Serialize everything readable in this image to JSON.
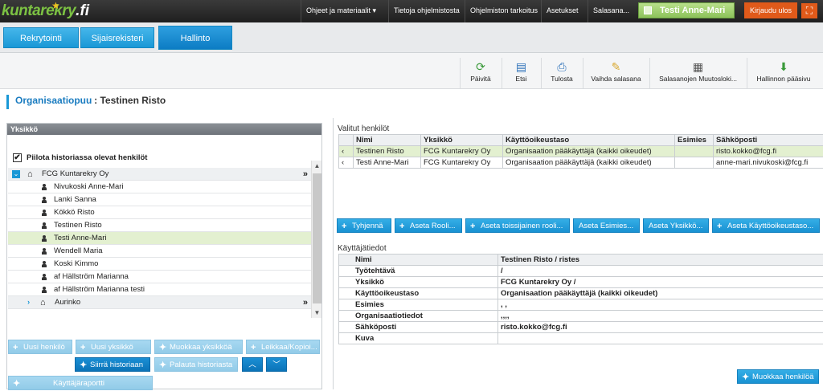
{
  "topbar": {
    "logo_main": "kuntarekry",
    "logo_suffix": ".fi",
    "links": [
      "Ohjeet ja materiaalit ▾",
      "Tietoja ohjelmistosta",
      "Ohjelmiston tarkoitus",
      "Asetukset",
      "Salasana..."
    ],
    "user": "Testi Anne-Mari",
    "logout": "Kirjaudu ulos"
  },
  "tabs": [
    "Rekrytointi",
    "Sijaisrekisteri",
    "Hallinto"
  ],
  "toolbar": [
    "Päivitä",
    "Etsi",
    "Tulosta",
    "Vaihda salasana",
    "Salasanojen Muutosloki...",
    "Hallinnon pääsivu"
  ],
  "page": {
    "title": "Organisaatiopuu",
    "subtitle": ": Testinen Risto"
  },
  "left": {
    "header": "Yksikkö",
    "hide_history": "Piilota historiassa olevat henkilöt",
    "root": "FCG Kuntarekry Oy",
    "people": [
      "Nivukoski Anne-Mari",
      "Lanki Sanna",
      "Kökkö Risto",
      "Testinen Risto",
      "Testi Anne-Mari",
      "Wendell Maria",
      "Koski Kimmo",
      "af Hällström Marianna",
      "af Hällström Marianna testi"
    ],
    "sub_unit": "Aurinko",
    "buttons": {
      "new_person": "Uusi henkilö",
      "new_unit": "Uusi yksikkö",
      "edit_unit": "Muokkaa yksikköä",
      "cut_copy": "Leikkaa/Kopioi...",
      "move_history": "Siirrä historiaan",
      "restore_history": "Palauta historiasta",
      "user_report": "Käyttäjäraportti"
    }
  },
  "right": {
    "selected_label": "Valitut henkilöt",
    "columns": [
      "Nimi",
      "Yksikkö",
      "Käyttöoikeustaso",
      "Esimies",
      "Sähköposti"
    ],
    "rows": [
      [
        "Testinen Risto",
        "FCG Kuntarekry Oy",
        "Organisaation pääkäyttäjä (kaikki oikeudet)",
        "",
        "risto.kokko@fcg.fi"
      ],
      [
        "Testi Anne-Mari",
        "FCG Kuntarekry Oy",
        "Organisaation pääkäyttäjä (kaikki oikeudet)",
        "",
        "anne-mari.nivukoski@fcg.fi"
      ]
    ],
    "buttons": [
      "Tyhjennä",
      "Aseta Rooli...",
      "Aseta toissijainen rooli...",
      "Aseta Esimies...",
      "Aseta Yksikkö...",
      "Aseta Käyttöoikeustaso..."
    ],
    "info_label": "Käyttäjätiedot",
    "info": [
      [
        "Nimi",
        "Testinen Risto / ristes"
      ],
      [
        "Työtehtävä",
        " /"
      ],
      [
        "Yksikkö",
        "FCG Kuntarekry Oy /"
      ],
      [
        "Käyttöoikeustaso",
        "Organisaation pääkäyttäjä (kaikki oikeudet)"
      ],
      [
        "Esimies",
        ", ,"
      ],
      [
        "Organisaatiotiedot",
        ",,,,"
      ],
      [
        "Sähköposti",
        "risto.kokko@fcg.fi"
      ],
      [
        "Kuva",
        ""
      ]
    ],
    "edit_person": "Muokkaa henkilöä"
  }
}
